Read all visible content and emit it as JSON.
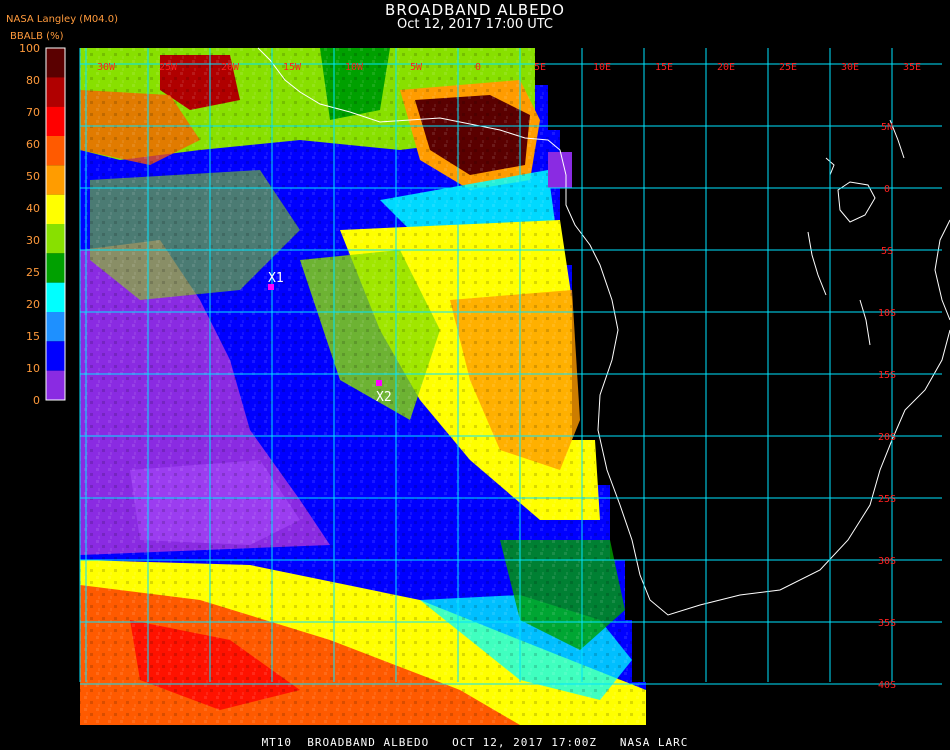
{
  "header": {
    "title": "BROADBAND ALBEDO",
    "subtitle": "Oct 12, 2017 17:00 UTC",
    "credit": "NASA Langley (M04.0)",
    "units_label": "BBALB (%)"
  },
  "footer": {
    "text": "MT10  BROADBAND ALBEDO   OCT 12, 2017 17:00Z   NASA LARC"
  },
  "colorbar": {
    "ticks": [
      "100",
      "80",
      "70",
      "60",
      "50",
      "40",
      "30",
      "25",
      "20",
      "15",
      "10",
      "0"
    ],
    "colors": [
      "#5a0000",
      "#b00000",
      "#ff0000",
      "#ff5a00",
      "#ff9c00",
      "#ffff00",
      "#88e000",
      "#00a000",
      "#00ffff",
      "#1e90ff",
      "#0000ff",
      "#8a2be2"
    ]
  },
  "map": {
    "grid_color": "#00e5ff",
    "label_color": "#ff2020",
    "lon_labels": [
      "30W",
      "25W",
      "20W",
      "15W",
      "10W",
      "5W",
      "0",
      "5E",
      "10E",
      "15E",
      "20E",
      "25E",
      "30E",
      "35E"
    ],
    "lat_labels": [
      "5N",
      "0",
      "5S",
      "10S",
      "15S",
      "20S",
      "25S",
      "30S",
      "35S",
      "40S"
    ],
    "markers": [
      {
        "label": "X1",
        "color": "#ff00ff"
      },
      {
        "label": "X2",
        "color": "#ff00ff"
      }
    ],
    "region_colors": {
      "clear_ocean": "#0000ff",
      "dark_ocean": "#8a2be2",
      "low_cloud": "#ffff00",
      "mid_cloud": "#88e000",
      "bright_cloud": "#ff5a00",
      "deep_convection": "#5a0000",
      "cyan_cloud": "#00ffff"
    }
  }
}
